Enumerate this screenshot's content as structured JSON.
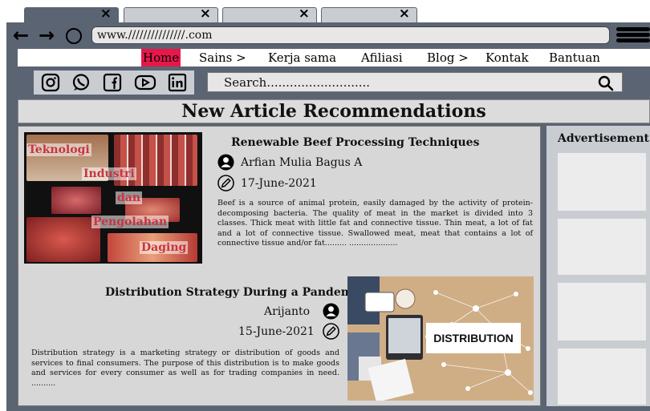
{
  "browser": {
    "tab_close": "×",
    "url": "www.///////////////.com"
  },
  "menu": {
    "items": [
      "Home",
      "Sains >",
      "Kerja sama",
      "Afiliasi",
      "Blog >",
      "Kontak",
      "Bantuan"
    ],
    "active": "Home"
  },
  "social": {
    "icons": [
      "instagram-icon",
      "whatsapp-icon",
      "facebook-icon",
      "youtube-icon",
      "linkedin-icon"
    ]
  },
  "search": {
    "placeholder": "Search..........................."
  },
  "page": {
    "title": "New Article Recommendations"
  },
  "articles": [
    {
      "title": "Renewable Beef Processing Techniques",
      "author": "Arfian Mulia Bagus A",
      "date": "17-June-2021",
      "body": "Beef is a source of animal protein, easily damaged by the activity of protein-decomposing bacteria. The quality of meat in the market is divided into 3 classes. Thick meat with little fat and connective tissue. Thin meat, a lot of fat and a lot of connective tissue. Swallowed meat, meat that contains a lot of connective tissue and/or fat.........  ....................",
      "image_words": [
        "Teknologi",
        "Industri",
        "dan",
        "Pengolahan",
        "Daging"
      ]
    },
    {
      "title": "Distribution Strategy During a Pandemic",
      "author": "Arijanto",
      "date": "15-June-2021",
      "body": "Distribution strategy is a marketing strategy or distribution of goods and services to final consumers. The purpose of this distribution is to make goods and services for every consumer as well as for trading companies in need. ..........",
      "image_label": "DISTRIBUTION"
    }
  ],
  "sidebar": {
    "title": "Advertisement"
  },
  "colors": {
    "frame": "#5b6472",
    "active_menu": "#e8174b",
    "panel": "#d7d7d7"
  }
}
